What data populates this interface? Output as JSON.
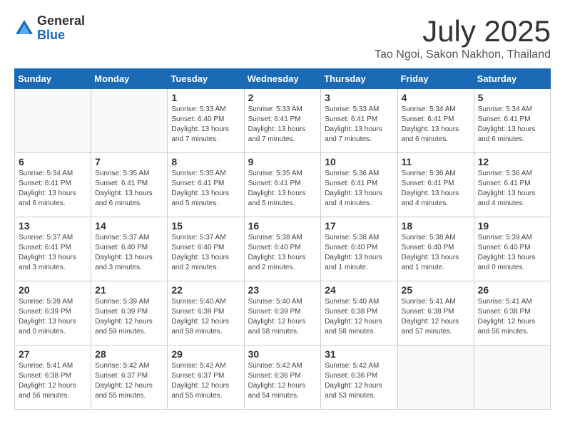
{
  "header": {
    "logo_general": "General",
    "logo_blue": "Blue",
    "title": "July 2025",
    "subtitle": "Tao Ngoi, Sakon Nakhon, Thailand"
  },
  "calendar": {
    "weekdays": [
      "Sunday",
      "Monday",
      "Tuesday",
      "Wednesday",
      "Thursday",
      "Friday",
      "Saturday"
    ],
    "weeks": [
      [
        {
          "day": "",
          "info": ""
        },
        {
          "day": "",
          "info": ""
        },
        {
          "day": "1",
          "info": "Sunrise: 5:33 AM\nSunset: 6:40 PM\nDaylight: 13 hours and 7 minutes."
        },
        {
          "day": "2",
          "info": "Sunrise: 5:33 AM\nSunset: 6:41 PM\nDaylight: 13 hours and 7 minutes."
        },
        {
          "day": "3",
          "info": "Sunrise: 5:33 AM\nSunset: 6:41 PM\nDaylight: 13 hours and 7 minutes."
        },
        {
          "day": "4",
          "info": "Sunrise: 5:34 AM\nSunset: 6:41 PM\nDaylight: 13 hours and 6 minutes."
        },
        {
          "day": "5",
          "info": "Sunrise: 5:34 AM\nSunset: 6:41 PM\nDaylight: 13 hours and 6 minutes."
        }
      ],
      [
        {
          "day": "6",
          "info": "Sunrise: 5:34 AM\nSunset: 6:41 PM\nDaylight: 13 hours and 6 minutes."
        },
        {
          "day": "7",
          "info": "Sunrise: 5:35 AM\nSunset: 6:41 PM\nDaylight: 13 hours and 6 minutes."
        },
        {
          "day": "8",
          "info": "Sunrise: 5:35 AM\nSunset: 6:41 PM\nDaylight: 13 hours and 5 minutes."
        },
        {
          "day": "9",
          "info": "Sunrise: 5:35 AM\nSunset: 6:41 PM\nDaylight: 13 hours and 5 minutes."
        },
        {
          "day": "10",
          "info": "Sunrise: 5:36 AM\nSunset: 6:41 PM\nDaylight: 13 hours and 4 minutes."
        },
        {
          "day": "11",
          "info": "Sunrise: 5:36 AM\nSunset: 6:41 PM\nDaylight: 13 hours and 4 minutes."
        },
        {
          "day": "12",
          "info": "Sunrise: 5:36 AM\nSunset: 6:41 PM\nDaylight: 13 hours and 4 minutes."
        }
      ],
      [
        {
          "day": "13",
          "info": "Sunrise: 5:37 AM\nSunset: 6:41 PM\nDaylight: 13 hours and 3 minutes."
        },
        {
          "day": "14",
          "info": "Sunrise: 5:37 AM\nSunset: 6:40 PM\nDaylight: 13 hours and 3 minutes."
        },
        {
          "day": "15",
          "info": "Sunrise: 5:37 AM\nSunset: 6:40 PM\nDaylight: 13 hours and 2 minutes."
        },
        {
          "day": "16",
          "info": "Sunrise: 5:38 AM\nSunset: 6:40 PM\nDaylight: 13 hours and 2 minutes."
        },
        {
          "day": "17",
          "info": "Sunrise: 5:38 AM\nSunset: 6:40 PM\nDaylight: 13 hours and 1 minute."
        },
        {
          "day": "18",
          "info": "Sunrise: 5:38 AM\nSunset: 6:40 PM\nDaylight: 13 hours and 1 minute."
        },
        {
          "day": "19",
          "info": "Sunrise: 5:39 AM\nSunset: 6:40 PM\nDaylight: 13 hours and 0 minutes."
        }
      ],
      [
        {
          "day": "20",
          "info": "Sunrise: 5:39 AM\nSunset: 6:39 PM\nDaylight: 13 hours and 0 minutes."
        },
        {
          "day": "21",
          "info": "Sunrise: 5:39 AM\nSunset: 6:39 PM\nDaylight: 12 hours and 59 minutes."
        },
        {
          "day": "22",
          "info": "Sunrise: 5:40 AM\nSunset: 6:39 PM\nDaylight: 12 hours and 58 minutes."
        },
        {
          "day": "23",
          "info": "Sunrise: 5:40 AM\nSunset: 6:39 PM\nDaylight: 12 hours and 58 minutes."
        },
        {
          "day": "24",
          "info": "Sunrise: 5:40 AM\nSunset: 6:38 PM\nDaylight: 12 hours and 58 minutes."
        },
        {
          "day": "25",
          "info": "Sunrise: 5:41 AM\nSunset: 6:38 PM\nDaylight: 12 hours and 57 minutes."
        },
        {
          "day": "26",
          "info": "Sunrise: 5:41 AM\nSunset: 6:38 PM\nDaylight: 12 hours and 56 minutes."
        }
      ],
      [
        {
          "day": "27",
          "info": "Sunrise: 5:41 AM\nSunset: 6:38 PM\nDaylight: 12 hours and 56 minutes."
        },
        {
          "day": "28",
          "info": "Sunrise: 5:42 AM\nSunset: 6:37 PM\nDaylight: 12 hours and 55 minutes."
        },
        {
          "day": "29",
          "info": "Sunrise: 5:42 AM\nSunset: 6:37 PM\nDaylight: 12 hours and 55 minutes."
        },
        {
          "day": "30",
          "info": "Sunrise: 5:42 AM\nSunset: 6:36 PM\nDaylight: 12 hours and 54 minutes."
        },
        {
          "day": "31",
          "info": "Sunrise: 5:42 AM\nSunset: 6:36 PM\nDaylight: 12 hours and 53 minutes."
        },
        {
          "day": "",
          "info": ""
        },
        {
          "day": "",
          "info": ""
        }
      ]
    ]
  }
}
